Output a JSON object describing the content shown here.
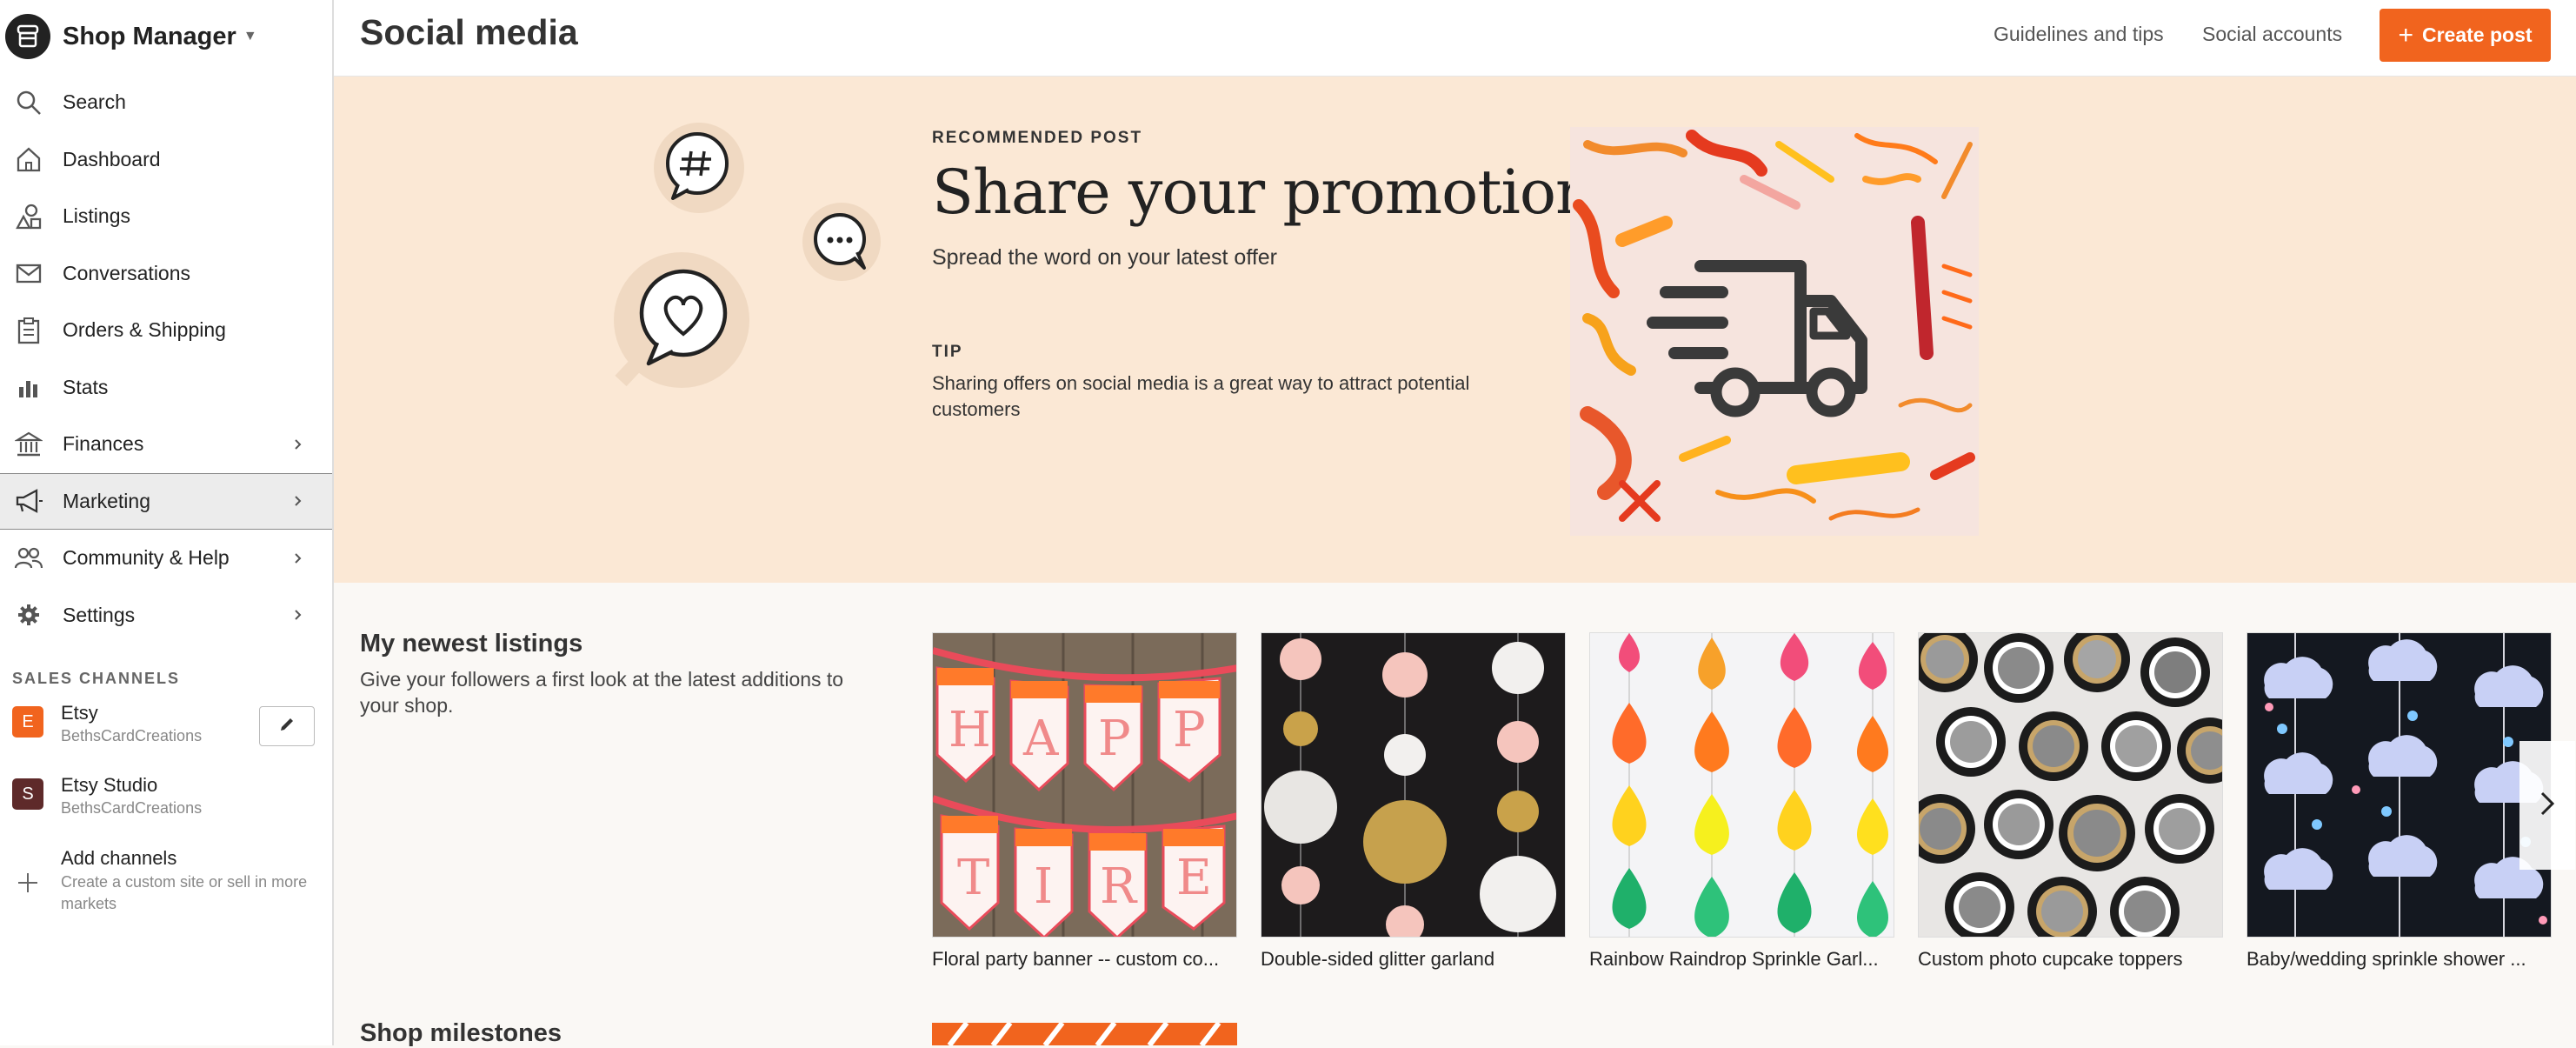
{
  "sidebar": {
    "brand_title": "Shop Manager",
    "nav": [
      {
        "label": "Search",
        "icon": "search-icon",
        "has_chevron": false
      },
      {
        "label": "Dashboard",
        "icon": "home-icon",
        "has_chevron": false
      },
      {
        "label": "Listings",
        "icon": "shapes-icon",
        "has_chevron": false
      },
      {
        "label": "Conversations",
        "icon": "envelope-icon",
        "has_chevron": false
      },
      {
        "label": "Orders & Shipping",
        "icon": "clipboard-icon",
        "has_chevron": false
      },
      {
        "label": "Stats",
        "icon": "bar-chart-icon",
        "has_chevron": false
      },
      {
        "label": "Finances",
        "icon": "bank-icon",
        "has_chevron": true
      },
      {
        "label": "Marketing",
        "icon": "megaphone-icon",
        "has_chevron": true,
        "active": true
      },
      {
        "label": "Community & Help",
        "icon": "people-icon",
        "has_chevron": true
      },
      {
        "label": "Settings",
        "icon": "gear-icon",
        "has_chevron": true
      }
    ],
    "channels_header": "SALES CHANNELS",
    "channels": [
      {
        "badge": "E",
        "name": "Etsy",
        "shop": "BethsCardCreations",
        "color": "#f1641e"
      },
      {
        "badge": "S",
        "name": "Etsy Studio",
        "shop": "BethsCardCreations",
        "color": "#5e2a2a"
      }
    ],
    "add_channel": {
      "title": "Add channels",
      "subtitle": "Create a custom site or sell in more markets"
    }
  },
  "topbar": {
    "title": "Social media",
    "links": [
      "Guidelines and tips",
      "Social accounts"
    ],
    "create_label": "Create post",
    "accent": "#f1641e"
  },
  "recommended": {
    "kicker": "RECOMMENDED POST",
    "title": "Share your promotion",
    "subtitle": "Spread the word on your latest offer",
    "tip_kicker": "TIP",
    "tip_text": "Sharing offers on social media is a great way to attract potential customers",
    "background": "#fbe8d5"
  },
  "newest": {
    "title": "My newest listings",
    "description": "Give your followers a first look at the latest additions to your shop.",
    "listings": [
      {
        "title": "Floral party banner -- custom co..."
      },
      {
        "title": "Double-sided glitter garland"
      },
      {
        "title": "Rainbow Raindrop Sprinkle Garl..."
      },
      {
        "title": "Custom photo cupcake toppers"
      },
      {
        "title": "Baby/wedding sprinkle shower ..."
      }
    ]
  },
  "milestones": {
    "title": "Shop milestones"
  }
}
